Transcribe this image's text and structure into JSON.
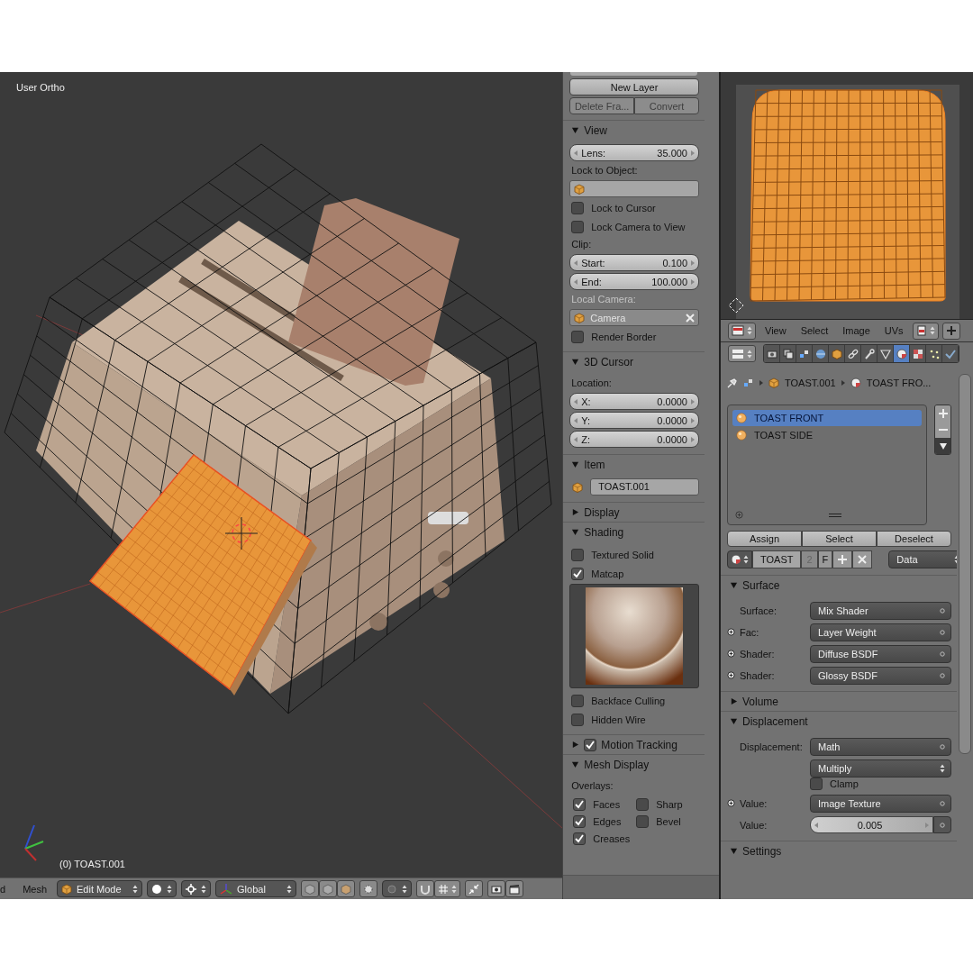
{
  "viewport": {
    "view_label": "User Ortho",
    "object_label": "(0) TOAST.001"
  },
  "viewport_header": {
    "menus": [
      "d",
      "Mesh"
    ],
    "mode": "Edit Mode",
    "orientation": "Global"
  },
  "n_panel": {
    "new_layer": "New Layer",
    "buttons": [
      {
        "label": "Delete Fra...",
        "disabled": true
      },
      {
        "label": "Convert",
        "disabled": true
      }
    ],
    "sections": [
      {
        "title": "View",
        "expanded": true,
        "rows": [
          {
            "kind": "number",
            "label": "Lens:",
            "value": "35.000"
          },
          {
            "kind": "label",
            "text": "Lock to Object:",
            "disabled": false
          },
          {
            "kind": "object",
            "disabled": false,
            "clear": false
          },
          {
            "kind": "checkbox",
            "label": "Lock to Cursor",
            "checked": false
          },
          {
            "kind": "checkbox",
            "label": "Lock Camera to View",
            "checked": false
          },
          {
            "kind": "label",
            "text": "Clip:",
            "disabled": false
          },
          {
            "kind": "number",
            "label": "Start:",
            "value": "0.100"
          },
          {
            "kind": "number",
            "label": "End:",
            "value": "100.000"
          },
          {
            "kind": "label",
            "text": "Local Camera:",
            "disabled": true
          },
          {
            "kind": "object",
            "value": "Camera",
            "disabled": true,
            "clear": true
          },
          {
            "kind": "checkbox",
            "label": "Render Border",
            "checked": false
          }
        ]
      },
      {
        "title": "3D Cursor",
        "expanded": true,
        "rows": [
          {
            "kind": "label",
            "text": "Location:",
            "disabled": false
          },
          {
            "kind": "number",
            "label": "X:",
            "value": "0.0000"
          },
          {
            "kind": "number",
            "label": "Y:",
            "value": "0.0000"
          },
          {
            "kind": "number",
            "label": "Z:",
            "value": "0.0000"
          }
        ]
      },
      {
        "title": "Item",
        "expanded": true,
        "rows": [
          {
            "kind": "name",
            "value": "TOAST.001"
          }
        ]
      },
      {
        "title": "Display",
        "expanded": false
      },
      {
        "title": "Shading",
        "expanded": true,
        "rows": [
          {
            "kind": "checkbox",
            "label": "Textured Solid",
            "checked": false
          },
          {
            "kind": "checkbox",
            "label": "Matcap",
            "checked": true
          },
          {
            "kind": "matcap"
          },
          {
            "kind": "checkbox",
            "label": "Backface Culling",
            "checked": false
          },
          {
            "kind": "checkbox",
            "label": "Hidden Wire",
            "checked": false
          }
        ]
      },
      {
        "title": "Motion Tracking",
        "expanded": false,
        "checked": true
      },
      {
        "title": "Mesh Display",
        "expanded": true,
        "rows": [
          {
            "kind": "label",
            "text": "Overlays:",
            "disabled": false
          },
          {
            "kind": "check_grid",
            "items": [
              {
                "label": "Faces",
                "checked": true
              },
              {
                "label": "Sharp",
                "checked": false
              },
              {
                "label": "Edges",
                "checked": true
              },
              {
                "label": "Bevel",
                "checked": false
              },
              {
                "label": "Creases",
                "checked": true
              }
            ]
          }
        ]
      }
    ]
  },
  "uv_editor": {
    "menus": [
      "View",
      "Select",
      "Image",
      "UVs"
    ]
  },
  "properties": {
    "tabs": [
      {
        "selected": false
      },
      {
        "selected": false
      },
      {
        "selected": false
      },
      {
        "selected": false
      },
      {
        "selected": false
      },
      {
        "selected": false
      },
      {
        "selected": false
      },
      {
        "selected": false
      },
      {
        "selected": true
      },
      {
        "selected": false
      },
      {
        "selected": false
      },
      {
        "selected": false
      }
    ],
    "breadcrumb": [
      "TOAST.001",
      "TOAST FRO..."
    ],
    "material_slots": [
      {
        "name": "TOAST FRONT",
        "selected": true
      },
      {
        "name": "TOAST SIDE",
        "selected": false
      }
    ],
    "slot_buttons": [
      "Assign",
      "Select",
      "Deselect"
    ],
    "material": {
      "name": "TOAST",
      "users": "2",
      "fake_user": "F",
      "link": "Data"
    },
    "sections": [
      {
        "title": "Surface",
        "expanded": true,
        "rows": [
          {
            "kind": "socket",
            "label": "Surface:",
            "value": "Mix Shader",
            "linked": false
          },
          {
            "kind": "socket",
            "label": "Fac:",
            "value": "Layer Weight",
            "linked": true
          },
          {
            "kind": "socket",
            "label": "Shader:",
            "value": "Diffuse BSDF",
            "linked": true
          },
          {
            "kind": "socket",
            "label": "Shader:",
            "value": "Glossy BSDF",
            "linked": true
          }
        ]
      },
      {
        "title": "Volume",
        "expanded": false
      },
      {
        "title": "Displacement",
        "expanded": true,
        "rows": [
          {
            "kind": "socket",
            "label": "Displacement:",
            "value": "Math",
            "linked": false
          },
          {
            "kind": "enum",
            "value": "Multiply"
          },
          {
            "kind": "checkbox",
            "label": "Clamp",
            "checked": false
          },
          {
            "kind": "socket",
            "label": "Value:",
            "value": "Image Texture",
            "linked": true
          },
          {
            "kind": "number",
            "label": "Value:",
            "value": "0.005",
            "linked": false
          }
        ]
      },
      {
        "title": "Settings",
        "expanded": true
      }
    ]
  }
}
